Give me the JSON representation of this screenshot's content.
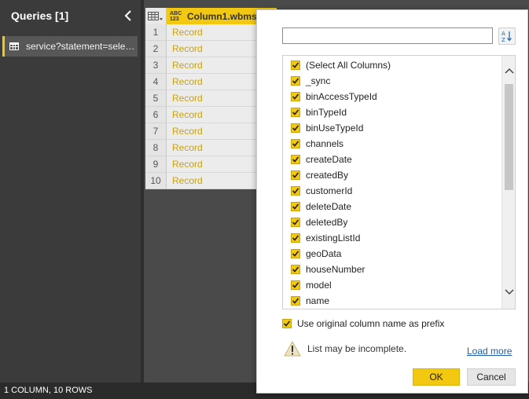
{
  "queries_pane": {
    "title": "Queries [1]",
    "items": [
      {
        "label": "service?statement=selec..."
      }
    ]
  },
  "grid": {
    "column": {
      "type_badge": "ABC\n123",
      "name": "Column1.wbms"
    },
    "rows": [
      {
        "num": "1",
        "value": "Record"
      },
      {
        "num": "2",
        "value": "Record"
      },
      {
        "num": "3",
        "value": "Record"
      },
      {
        "num": "4",
        "value": "Record"
      },
      {
        "num": "5",
        "value": "Record"
      },
      {
        "num": "6",
        "value": "Record"
      },
      {
        "num": "7",
        "value": "Record"
      },
      {
        "num": "8",
        "value": "Record"
      },
      {
        "num": "9",
        "value": "Record"
      },
      {
        "num": "10",
        "value": "Record"
      }
    ]
  },
  "status_bar": {
    "text": "1 COLUMN, 10 ROWS"
  },
  "expand_popup": {
    "search": {
      "value": "",
      "placeholder": ""
    },
    "columns": [
      {
        "label": "(Select All Columns)",
        "checked": true
      },
      {
        "label": "_sync",
        "checked": true
      },
      {
        "label": "binAccessTypeId",
        "checked": true
      },
      {
        "label": "binTypeId",
        "checked": true
      },
      {
        "label": "binUseTypeId",
        "checked": true
      },
      {
        "label": "channels",
        "checked": true
      },
      {
        "label": "createDate",
        "checked": true
      },
      {
        "label": "createdBy",
        "checked": true
      },
      {
        "label": "customerId",
        "checked": true
      },
      {
        "label": "deleteDate",
        "checked": true
      },
      {
        "label": "deletedBy",
        "checked": true
      },
      {
        "label": "existingListId",
        "checked": true
      },
      {
        "label": "geoData",
        "checked": true
      },
      {
        "label": "houseNumber",
        "checked": true
      },
      {
        "label": "model",
        "checked": true
      },
      {
        "label": "name",
        "checked": true
      }
    ],
    "use_prefix": {
      "label": "Use original column name as prefix",
      "checked": true
    },
    "warning": "List may be incomplete.",
    "load_more": "Load more",
    "ok": "OK",
    "cancel": "Cancel"
  },
  "colors": {
    "accent": "#f2c811",
    "pane_bg": "#3b3b3b",
    "record_text": "#c8a214",
    "link": "#1c5fa8"
  },
  "icons": {
    "collapse": "chevron-left-icon",
    "query": "table-icon",
    "table_menu": "table-icon",
    "expand": "expand-icon",
    "sort": "sort-az-icon",
    "warning": "warning-icon"
  }
}
